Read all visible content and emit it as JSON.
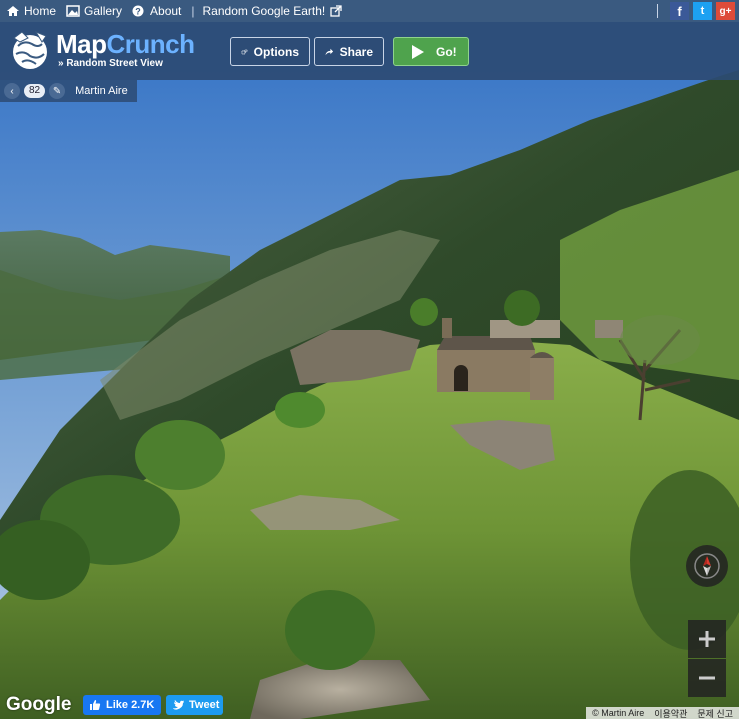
{
  "topnav": {
    "home": "Home",
    "gallery": "Gallery",
    "about": "About",
    "separator": "|",
    "random_earth": "Random Google Earth!",
    "social": {
      "facebook": "f",
      "twitter": "t",
      "gplus": "g+"
    }
  },
  "header": {
    "logo_map": "Map",
    "logo_crunch": "Crunch",
    "tagline": "» Random Street View",
    "options_label": "Options",
    "share_label": "Share",
    "go_label": "Go!"
  },
  "location": {
    "prev": "‹",
    "count": "82",
    "edit": "✎",
    "author": "Martin Aire"
  },
  "bottom": {
    "google": "Google",
    "like_label": "Like 2.7K",
    "tweet_label": "Tweet",
    "credit_author": "© Martin Aire",
    "terms": "이용약관",
    "report": "문제 신고"
  },
  "colors": {
    "accent": "#3a5a80",
    "go_green": "#4fa34d",
    "crunch_blue": "#6cb2ff"
  }
}
